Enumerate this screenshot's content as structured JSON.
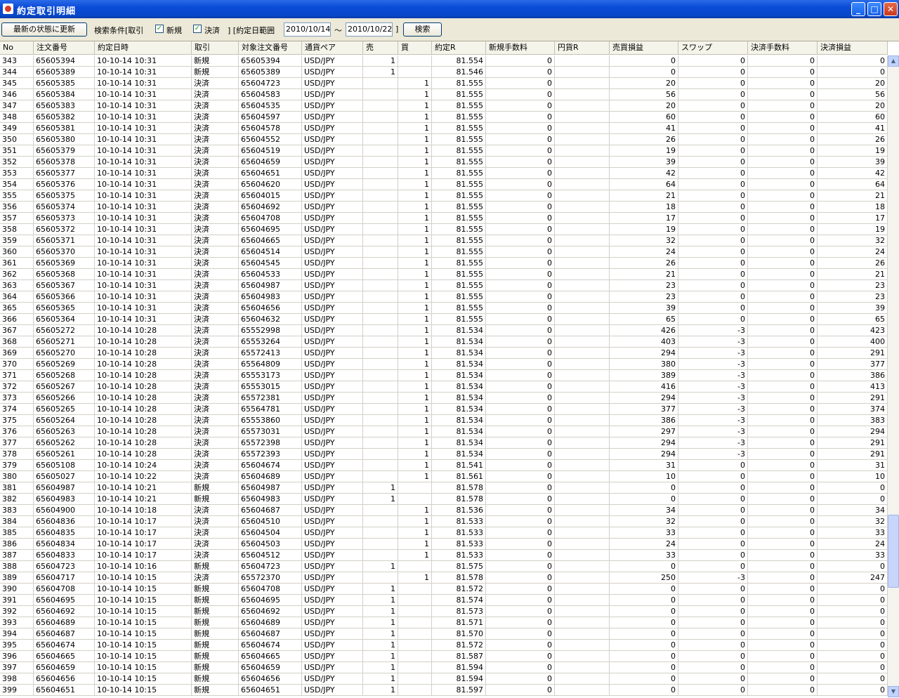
{
  "window": {
    "title": "約定取引明細",
    "min_label": "_",
    "max_label": "□",
    "close_label": "✕"
  },
  "toolbar": {
    "refresh_label": "最新の状態に更新",
    "filter_label": "検索条件[取引",
    "new_label": "新規",
    "settle_label": "決済",
    "range_label": "]  [約定日範囲",
    "date_from": "2010/10/14",
    "tilde": "〜",
    "date_to": "2010/10/22",
    "range_close": "]",
    "search_label": "検索",
    "check_mark": "✓"
  },
  "columns": [
    "No",
    "注文番号",
    "約定日時",
    "取引",
    "対象注文番号",
    "通貨ペア",
    "売",
    "買",
    "約定R",
    "新規手数料",
    "円貨R",
    "売買損益",
    "スワップ",
    "決済手数料",
    "決済損益"
  ],
  "rows": [
    [
      "343",
      "65605394",
      "10-10-14 10:31",
      "新規",
      "65605394",
      "USD/JPY",
      "1",
      "",
      "81.554",
      "0",
      "",
      "0",
      "0",
      "0",
      "0"
    ],
    [
      "344",
      "65605389",
      "10-10-14 10:31",
      "新規",
      "65605389",
      "USD/JPY",
      "1",
      "",
      "81.546",
      "0",
      "",
      "0",
      "0",
      "0",
      "0"
    ],
    [
      "345",
      "65605385",
      "10-10-14 10:31",
      "決済",
      "65604723",
      "USD/JPY",
      "",
      "1",
      "81.555",
      "0",
      "",
      "20",
      "0",
      "0",
      "20"
    ],
    [
      "346",
      "65605384",
      "10-10-14 10:31",
      "決済",
      "65604583",
      "USD/JPY",
      "",
      "1",
      "81.555",
      "0",
      "",
      "56",
      "0",
      "0",
      "56"
    ],
    [
      "347",
      "65605383",
      "10-10-14 10:31",
      "決済",
      "65604535",
      "USD/JPY",
      "",
      "1",
      "81.555",
      "0",
      "",
      "20",
      "0",
      "0",
      "20"
    ],
    [
      "348",
      "65605382",
      "10-10-14 10:31",
      "決済",
      "65604597",
      "USD/JPY",
      "",
      "1",
      "81.555",
      "0",
      "",
      "60",
      "0",
      "0",
      "60"
    ],
    [
      "349",
      "65605381",
      "10-10-14 10:31",
      "決済",
      "65604578",
      "USD/JPY",
      "",
      "1",
      "81.555",
      "0",
      "",
      "41",
      "0",
      "0",
      "41"
    ],
    [
      "350",
      "65605380",
      "10-10-14 10:31",
      "決済",
      "65604552",
      "USD/JPY",
      "",
      "1",
      "81.555",
      "0",
      "",
      "26",
      "0",
      "0",
      "26"
    ],
    [
      "351",
      "65605379",
      "10-10-14 10:31",
      "決済",
      "65604519",
      "USD/JPY",
      "",
      "1",
      "81.555",
      "0",
      "",
      "19",
      "0",
      "0",
      "19"
    ],
    [
      "352",
      "65605378",
      "10-10-14 10:31",
      "決済",
      "65604659",
      "USD/JPY",
      "",
      "1",
      "81.555",
      "0",
      "",
      "39",
      "0",
      "0",
      "39"
    ],
    [
      "353",
      "65605377",
      "10-10-14 10:31",
      "決済",
      "65604651",
      "USD/JPY",
      "",
      "1",
      "81.555",
      "0",
      "",
      "42",
      "0",
      "0",
      "42"
    ],
    [
      "354",
      "65605376",
      "10-10-14 10:31",
      "決済",
      "65604620",
      "USD/JPY",
      "",
      "1",
      "81.555",
      "0",
      "",
      "64",
      "0",
      "0",
      "64"
    ],
    [
      "355",
      "65605375",
      "10-10-14 10:31",
      "決済",
      "65604015",
      "USD/JPY",
      "",
      "1",
      "81.555",
      "0",
      "",
      "21",
      "0",
      "0",
      "21"
    ],
    [
      "356",
      "65605374",
      "10-10-14 10:31",
      "決済",
      "65604692",
      "USD/JPY",
      "",
      "1",
      "81.555",
      "0",
      "",
      "18",
      "0",
      "0",
      "18"
    ],
    [
      "357",
      "65605373",
      "10-10-14 10:31",
      "決済",
      "65604708",
      "USD/JPY",
      "",
      "1",
      "81.555",
      "0",
      "",
      "17",
      "0",
      "0",
      "17"
    ],
    [
      "358",
      "65605372",
      "10-10-14 10:31",
      "決済",
      "65604695",
      "USD/JPY",
      "",
      "1",
      "81.555",
      "0",
      "",
      "19",
      "0",
      "0",
      "19"
    ],
    [
      "359",
      "65605371",
      "10-10-14 10:31",
      "決済",
      "65604665",
      "USD/JPY",
      "",
      "1",
      "81.555",
      "0",
      "",
      "32",
      "0",
      "0",
      "32"
    ],
    [
      "360",
      "65605370",
      "10-10-14 10:31",
      "決済",
      "65604514",
      "USD/JPY",
      "",
      "1",
      "81.555",
      "0",
      "",
      "24",
      "0",
      "0",
      "24"
    ],
    [
      "361",
      "65605369",
      "10-10-14 10:31",
      "決済",
      "65604545",
      "USD/JPY",
      "",
      "1",
      "81.555",
      "0",
      "",
      "26",
      "0",
      "0",
      "26"
    ],
    [
      "362",
      "65605368",
      "10-10-14 10:31",
      "決済",
      "65604533",
      "USD/JPY",
      "",
      "1",
      "81.555",
      "0",
      "",
      "21",
      "0",
      "0",
      "21"
    ],
    [
      "363",
      "65605367",
      "10-10-14 10:31",
      "決済",
      "65604987",
      "USD/JPY",
      "",
      "1",
      "81.555",
      "0",
      "",
      "23",
      "0",
      "0",
      "23"
    ],
    [
      "364",
      "65605366",
      "10-10-14 10:31",
      "決済",
      "65604983",
      "USD/JPY",
      "",
      "1",
      "81.555",
      "0",
      "",
      "23",
      "0",
      "0",
      "23"
    ],
    [
      "365",
      "65605365",
      "10-10-14 10:31",
      "決済",
      "65604656",
      "USD/JPY",
      "",
      "1",
      "81.555",
      "0",
      "",
      "39",
      "0",
      "0",
      "39"
    ],
    [
      "366",
      "65605364",
      "10-10-14 10:31",
      "決済",
      "65604632",
      "USD/JPY",
      "",
      "1",
      "81.555",
      "0",
      "",
      "65",
      "0",
      "0",
      "65"
    ],
    [
      "367",
      "65605272",
      "10-10-14 10:28",
      "決済",
      "65552998",
      "USD/JPY",
      "",
      "1",
      "81.534",
      "0",
      "",
      "426",
      "-3",
      "0",
      "423"
    ],
    [
      "368",
      "65605271",
      "10-10-14 10:28",
      "決済",
      "65553264",
      "USD/JPY",
      "",
      "1",
      "81.534",
      "0",
      "",
      "403",
      "-3",
      "0",
      "400"
    ],
    [
      "369",
      "65605270",
      "10-10-14 10:28",
      "決済",
      "65572413",
      "USD/JPY",
      "",
      "1",
      "81.534",
      "0",
      "",
      "294",
      "-3",
      "0",
      "291"
    ],
    [
      "370",
      "65605269",
      "10-10-14 10:28",
      "決済",
      "65564809",
      "USD/JPY",
      "",
      "1",
      "81.534",
      "0",
      "",
      "380",
      "-3",
      "0",
      "377"
    ],
    [
      "371",
      "65605268",
      "10-10-14 10:28",
      "決済",
      "65553173",
      "USD/JPY",
      "",
      "1",
      "81.534",
      "0",
      "",
      "389",
      "-3",
      "0",
      "386"
    ],
    [
      "372",
      "65605267",
      "10-10-14 10:28",
      "決済",
      "65553015",
      "USD/JPY",
      "",
      "1",
      "81.534",
      "0",
      "",
      "416",
      "-3",
      "0",
      "413"
    ],
    [
      "373",
      "65605266",
      "10-10-14 10:28",
      "決済",
      "65572381",
      "USD/JPY",
      "",
      "1",
      "81.534",
      "0",
      "",
      "294",
      "-3",
      "0",
      "291"
    ],
    [
      "374",
      "65605265",
      "10-10-14 10:28",
      "決済",
      "65564781",
      "USD/JPY",
      "",
      "1",
      "81.534",
      "0",
      "",
      "377",
      "-3",
      "0",
      "374"
    ],
    [
      "375",
      "65605264",
      "10-10-14 10:28",
      "決済",
      "65553860",
      "USD/JPY",
      "",
      "1",
      "81.534",
      "0",
      "",
      "386",
      "-3",
      "0",
      "383"
    ],
    [
      "376",
      "65605263",
      "10-10-14 10:28",
      "決済",
      "65573031",
      "USD/JPY",
      "",
      "1",
      "81.534",
      "0",
      "",
      "297",
      "-3",
      "0",
      "294"
    ],
    [
      "377",
      "65605262",
      "10-10-14 10:28",
      "決済",
      "65572398",
      "USD/JPY",
      "",
      "1",
      "81.534",
      "0",
      "",
      "294",
      "-3",
      "0",
      "291"
    ],
    [
      "378",
      "65605261",
      "10-10-14 10:28",
      "決済",
      "65572393",
      "USD/JPY",
      "",
      "1",
      "81.534",
      "0",
      "",
      "294",
      "-3",
      "0",
      "291"
    ],
    [
      "379",
      "65605108",
      "10-10-14 10:24",
      "決済",
      "65604674",
      "USD/JPY",
      "",
      "1",
      "81.541",
      "0",
      "",
      "31",
      "0",
      "0",
      "31"
    ],
    [
      "380",
      "65605027",
      "10-10-14 10:22",
      "決済",
      "65604689",
      "USD/JPY",
      "",
      "1",
      "81.561",
      "0",
      "",
      "10",
      "0",
      "0",
      "10"
    ],
    [
      "381",
      "65604987",
      "10-10-14 10:21",
      "新規",
      "65604987",
      "USD/JPY",
      "1",
      "",
      "81.578",
      "0",
      "",
      "0",
      "0",
      "0",
      "0"
    ],
    [
      "382",
      "65604983",
      "10-10-14 10:21",
      "新規",
      "65604983",
      "USD/JPY",
      "1",
      "",
      "81.578",
      "0",
      "",
      "0",
      "0",
      "0",
      "0"
    ],
    [
      "383",
      "65604900",
      "10-10-14 10:18",
      "決済",
      "65604687",
      "USD/JPY",
      "",
      "1",
      "81.536",
      "0",
      "",
      "34",
      "0",
      "0",
      "34"
    ],
    [
      "384",
      "65604836",
      "10-10-14 10:17",
      "決済",
      "65604510",
      "USD/JPY",
      "",
      "1",
      "81.533",
      "0",
      "",
      "32",
      "0",
      "0",
      "32"
    ],
    [
      "385",
      "65604835",
      "10-10-14 10:17",
      "決済",
      "65604504",
      "USD/JPY",
      "",
      "1",
      "81.533",
      "0",
      "",
      "33",
      "0",
      "0",
      "33"
    ],
    [
      "386",
      "65604834",
      "10-10-14 10:17",
      "決済",
      "65604503",
      "USD/JPY",
      "",
      "1",
      "81.533",
      "0",
      "",
      "24",
      "0",
      "0",
      "24"
    ],
    [
      "387",
      "65604833",
      "10-10-14 10:17",
      "決済",
      "65604512",
      "USD/JPY",
      "",
      "1",
      "81.533",
      "0",
      "",
      "33",
      "0",
      "0",
      "33"
    ],
    [
      "388",
      "65604723",
      "10-10-14 10:16",
      "新規",
      "65604723",
      "USD/JPY",
      "1",
      "",
      "81.575",
      "0",
      "",
      "0",
      "0",
      "0",
      "0"
    ],
    [
      "389",
      "65604717",
      "10-10-14 10:15",
      "決済",
      "65572370",
      "USD/JPY",
      "",
      "1",
      "81.578",
      "0",
      "",
      "250",
      "-3",
      "0",
      "247"
    ],
    [
      "390",
      "65604708",
      "10-10-14 10:15",
      "新規",
      "65604708",
      "USD/JPY",
      "1",
      "",
      "81.572",
      "0",
      "",
      "0",
      "0",
      "0",
      "0"
    ],
    [
      "391",
      "65604695",
      "10-10-14 10:15",
      "新規",
      "65604695",
      "USD/JPY",
      "1",
      "",
      "81.574",
      "0",
      "",
      "0",
      "0",
      "0",
      "0"
    ],
    [
      "392",
      "65604692",
      "10-10-14 10:15",
      "新規",
      "65604692",
      "USD/JPY",
      "1",
      "",
      "81.573",
      "0",
      "",
      "0",
      "0",
      "0",
      "0"
    ],
    [
      "393",
      "65604689",
      "10-10-14 10:15",
      "新規",
      "65604689",
      "USD/JPY",
      "1",
      "",
      "81.571",
      "0",
      "",
      "0",
      "0",
      "0",
      "0"
    ],
    [
      "394",
      "65604687",
      "10-10-14 10:15",
      "新規",
      "65604687",
      "USD/JPY",
      "1",
      "",
      "81.570",
      "0",
      "",
      "0",
      "0",
      "0",
      "0"
    ],
    [
      "395",
      "65604674",
      "10-10-14 10:15",
      "新規",
      "65604674",
      "USD/JPY",
      "1",
      "",
      "81.572",
      "0",
      "",
      "0",
      "0",
      "0",
      "0"
    ],
    [
      "396",
      "65604665",
      "10-10-14 10:15",
      "新規",
      "65604665",
      "USD/JPY",
      "1",
      "",
      "81.587",
      "0",
      "",
      "0",
      "0",
      "0",
      "0"
    ],
    [
      "397",
      "65604659",
      "10-10-14 10:15",
      "新規",
      "65604659",
      "USD/JPY",
      "1",
      "",
      "81.594",
      "0",
      "",
      "0",
      "0",
      "0",
      "0"
    ],
    [
      "398",
      "65604656",
      "10-10-14 10:15",
      "新規",
      "65604656",
      "USD/JPY",
      "1",
      "",
      "81.594",
      "0",
      "",
      "0",
      "0",
      "0",
      "0"
    ],
    [
      "399",
      "65604651",
      "10-10-14 10:15",
      "新規",
      "65604651",
      "USD/JPY",
      "1",
      "",
      "81.597",
      "0",
      "",
      "0",
      "0",
      "0",
      "0"
    ]
  ],
  "scrollbar": {
    "up_glyph": "▲",
    "down_glyph": "▼"
  }
}
